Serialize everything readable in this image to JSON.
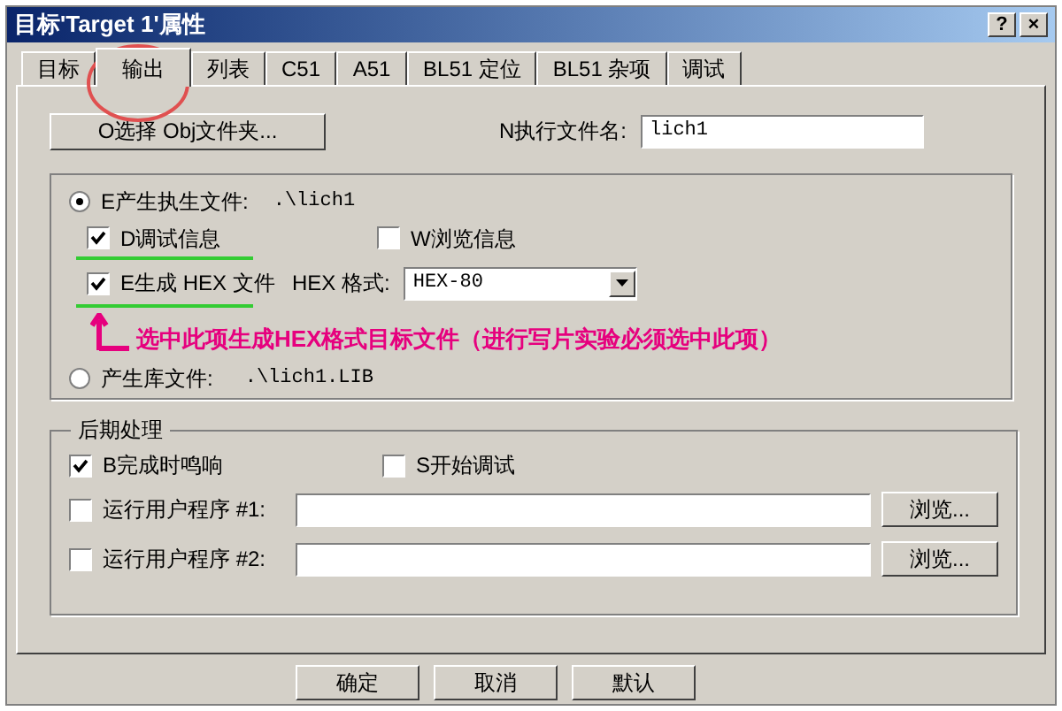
{
  "window": {
    "title": "目标'Target 1'属性",
    "title_buttons": [
      "?",
      "×"
    ]
  },
  "tabs": [
    {
      "label": "目标",
      "selected": false
    },
    {
      "label": "输出",
      "selected": true
    },
    {
      "label": "列表",
      "selected": false
    },
    {
      "label": "C51",
      "selected": false
    },
    {
      "label": "A51",
      "selected": false
    },
    {
      "label": "BL51 定位",
      "selected": false
    },
    {
      "label": "BL51 杂项",
      "selected": false
    },
    {
      "label": "调试",
      "selected": false
    }
  ],
  "output_folder_button": "O选择 Obj文件夹...",
  "executable_name": {
    "label": "N执行文件名:",
    "value": "lich1"
  },
  "output_group": {
    "create_executable": {
      "label": "E产生执生文件:",
      "path": ".\\lich1",
      "selected": true
    },
    "debug_info": {
      "label": "D调试信息",
      "checked": true
    },
    "browse_info": {
      "label": "W浏览信息",
      "checked": false
    },
    "create_hex": {
      "label": "E生成 HEX 文件",
      "checked": true
    },
    "hex_format": {
      "label": "HEX 格式:",
      "value": "HEX-80"
    },
    "annotation": "选中此项生成HEX格式目标文件（进行写片实验必须选中此项）",
    "create_library": {
      "label": "产生库文件:",
      "path": ".\\lich1.LIB",
      "selected": false
    }
  },
  "post_processing": {
    "title": "后期处理",
    "beep": {
      "label": "B完成时鸣响",
      "checked": true
    },
    "start_debug": {
      "label": "S开始调试",
      "checked": false
    },
    "user_programs": [
      {
        "label": "运行用户程序 #1:",
        "checked": false,
        "browse": "浏览..."
      },
      {
        "label": "运行用户程序 #2:",
        "checked": false,
        "browse": "浏览..."
      }
    ]
  },
  "buttons": [
    "确定",
    "取消",
    "默认"
  ]
}
